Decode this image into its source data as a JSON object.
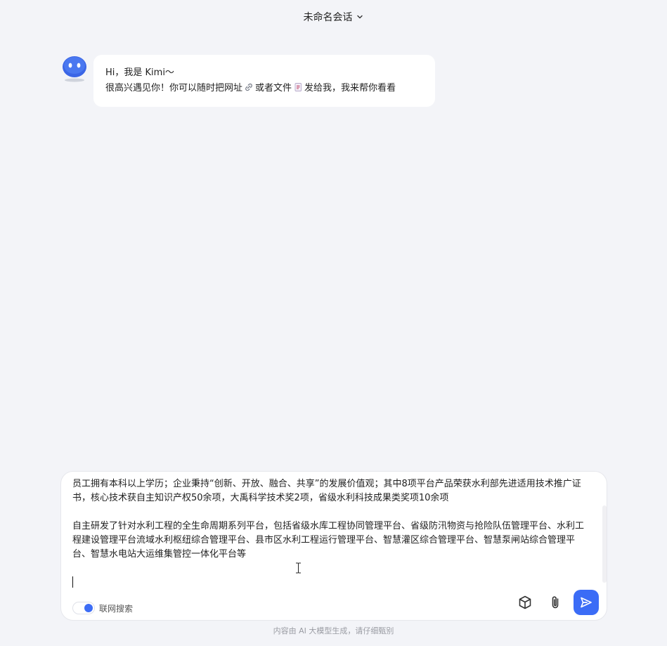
{
  "header": {
    "title": "未命名会话"
  },
  "bot": {
    "greeting": "Hi，我是 Kimi～",
    "line2_part1": "很高兴遇见你！你可以随时把网址",
    "line2_part2": "或者文件",
    "line2_part3": "发给我，我来帮你看看"
  },
  "composer": {
    "paragraph1": "员工拥有本科以上学历；企业秉持“创新、开放、融合、共享”的发展价值观；其中8项平台产品荣获水利部先进适用技术推广证书，核心技术获自主知识产权50余项，大禹科学技术奖2项，省级水利科技成果类奖项10余项",
    "paragraph2": "自主研发了针对水利工程的全生命周期系列平台，包括省级水库工程协同管理平台、省级防汛物资与抢险队伍管理平台、水利工程建设管理平台流域水利枢纽综合管理平台、县市区水利工程运行管理平台、智慧灌区综合管理平台、智慧泵闸站综合管理平台、智慧水电站大运维集管控一体化平台等",
    "web_search_label": "联网搜索",
    "web_search_on": true
  },
  "footer": {
    "disclaimer": "内容由 AI 大模型生成，请仔细甄别"
  },
  "colors": {
    "accent": "#3b6cf6",
    "background": "#f3f4f8"
  },
  "icons": [
    "chevron-down-icon",
    "kimi-avatar",
    "link-icon",
    "file-icon",
    "cube-icon",
    "paperclip-icon",
    "send-icon"
  ]
}
